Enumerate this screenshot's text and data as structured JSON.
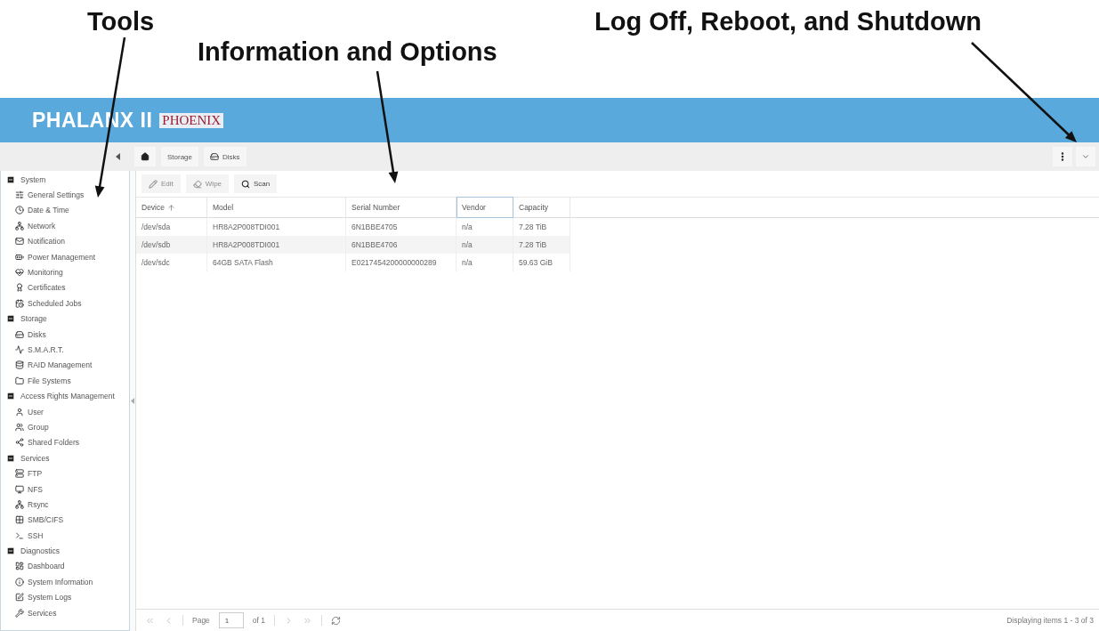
{
  "annotations": [
    {
      "text": "Tools"
    },
    {
      "text": "Information and Options"
    },
    {
      "text": "Log Off, Reboot, and Shutdown"
    }
  ],
  "header": {
    "title": "PHALANX II",
    "logo_text": "PHOENIX"
  },
  "breadcrumb": [
    {
      "label": "Storage"
    },
    {
      "label": "Disks"
    }
  ],
  "sidebar": {
    "groups": [
      {
        "label": "System",
        "expanded": true,
        "children": [
          {
            "label": "General Settings"
          },
          {
            "label": "Date & Time"
          },
          {
            "label": "Network"
          },
          {
            "label": "Notification"
          },
          {
            "label": "Power Management"
          },
          {
            "label": "Monitoring"
          },
          {
            "label": "Certificates"
          },
          {
            "label": "Scheduled Jobs"
          }
        ]
      },
      {
        "label": "Storage",
        "expanded": true,
        "children": [
          {
            "label": "Disks"
          },
          {
            "label": "S.M.A.R.T."
          },
          {
            "label": "RAID Management"
          },
          {
            "label": "File Systems"
          }
        ]
      },
      {
        "label": "Access Rights Management",
        "expanded": true,
        "children": [
          {
            "label": "User"
          },
          {
            "label": "Group"
          },
          {
            "label": "Shared Folders"
          }
        ]
      },
      {
        "label": "Services",
        "expanded": true,
        "children": [
          {
            "label": "FTP"
          },
          {
            "label": "NFS"
          },
          {
            "label": "Rsync"
          },
          {
            "label": "SMB/CIFS"
          },
          {
            "label": "SSH"
          }
        ]
      },
      {
        "label": "Diagnostics",
        "expanded": true,
        "children": [
          {
            "label": "Dashboard"
          },
          {
            "label": "System Information"
          },
          {
            "label": "System Logs"
          },
          {
            "label": "Services"
          }
        ]
      }
    ]
  },
  "actions": [
    {
      "kind": "edit",
      "label": "Edit",
      "disabled": true
    },
    {
      "kind": "wipe",
      "label": "Wipe",
      "disabled": true
    },
    {
      "kind": "scan",
      "label": "Scan",
      "disabled": false
    }
  ],
  "table": {
    "columns": [
      {
        "label": "Device",
        "sorted": true,
        "focused": false
      },
      {
        "label": "Model",
        "sorted": false,
        "focused": false
      },
      {
        "label": "Serial Number",
        "sorted": false,
        "focused": false
      },
      {
        "label": "Vendor",
        "sorted": false,
        "focused": true
      },
      {
        "label": "Capacity",
        "sorted": false,
        "focused": false
      }
    ],
    "rows": [
      [
        "/dev/sda",
        "HR8A2P008TDI001",
        "6N1BBE4705",
        "n/a",
        "7.28 TiB"
      ],
      [
        "/dev/sdb",
        "HR8A2P008TDI001",
        "6N1BBE4706",
        "n/a",
        "7.28 TiB"
      ],
      [
        "/dev/sdc",
        "64GB SATA Flash",
        "E0217454200000000289",
        "n/a",
        "59.63 GiB"
      ]
    ]
  },
  "pager": {
    "page_label": "Page",
    "page": "1",
    "of_label": "of 1",
    "status": "Displaying items 1 - 3 of 3"
  }
}
